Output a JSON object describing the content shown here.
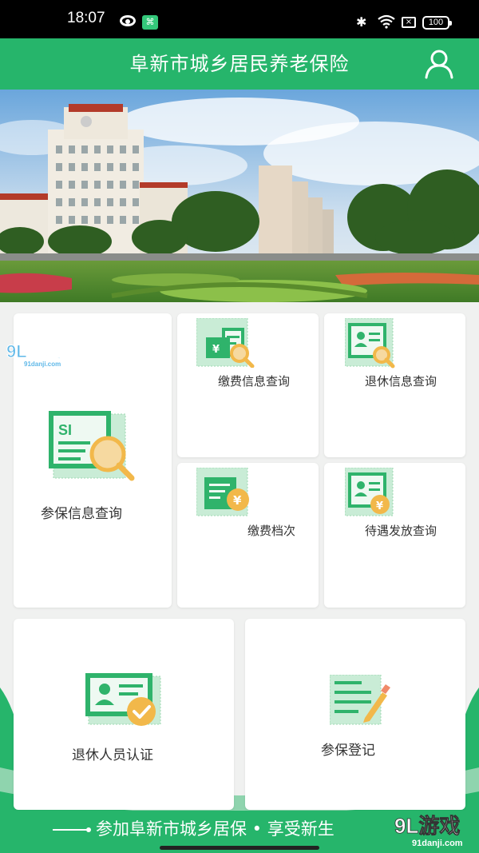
{
  "status_bar": {
    "time": "18:07",
    "app_badge": "⌘",
    "bluetooth": "✱",
    "battery": "100"
  },
  "header": {
    "title": "阜新市城乡居民养老保险",
    "user_icon": "user-icon"
  },
  "banner": {
    "alt": "city-square-photo"
  },
  "services": {
    "enrollment_query": "参保信息查询",
    "payment_query": "缴费信息查询",
    "retirement_query": "退休信息查询",
    "payment_level": "缴费档次",
    "benefit_query": "待遇发放查询",
    "retiree_verify": "退休人员认证",
    "enroll_register": "参保登记"
  },
  "icons": {
    "si_text": "SI",
    "yuan": "¥"
  },
  "slogan": "参加阜新市城乡居保 • 享受新生",
  "watermark": {
    "logo_text": "9L游戏",
    "logo_url": "91danji.com"
  },
  "colors": {
    "brand_green": "#26b56b",
    "icon_green": "#2fb36b",
    "icon_orange": "#f2b84a"
  }
}
